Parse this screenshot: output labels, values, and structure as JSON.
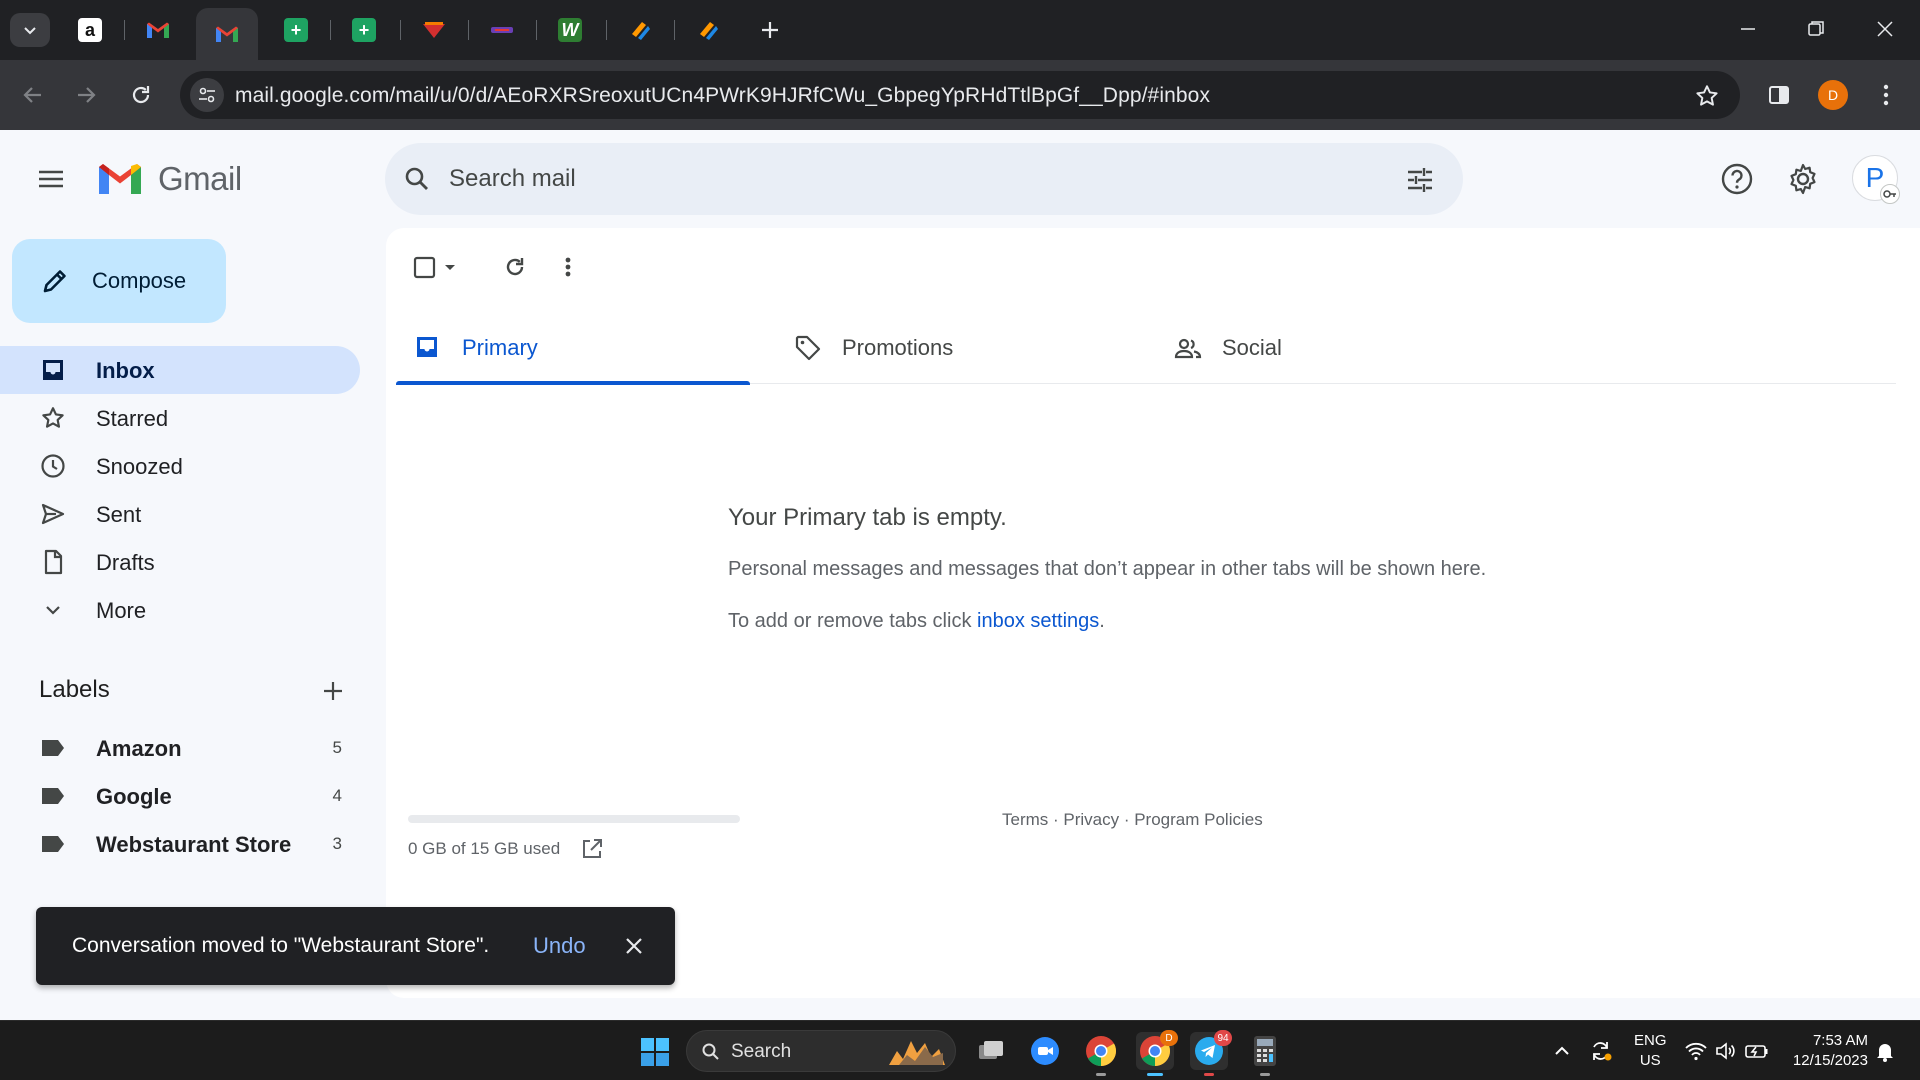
{
  "browser": {
    "tabs": [
      {
        "name": "amazon",
        "glyph": "a"
      },
      {
        "name": "gmail-1",
        "glyph": "M"
      },
      {
        "name": "gmail-active",
        "glyph": "M"
      },
      {
        "name": "sheets-1",
        "glyph": "+"
      },
      {
        "name": "sheets-2",
        "glyph": "+"
      },
      {
        "name": "app-red",
        "glyph": ""
      },
      {
        "name": "app-purple",
        "glyph": ""
      },
      {
        "name": "w-app",
        "glyph": "W"
      },
      {
        "name": "app-orange-1",
        "glyph": ""
      },
      {
        "name": "app-orange-2",
        "glyph": ""
      }
    ],
    "url": "mail.google.com/mail/u/0/d/AEoRXRSreoxutUCn4PWrK9HJRfCWu_GbpegYpRHdTtlBpGf__Dpp/#inbox",
    "profile_initial": "D"
  },
  "gmail": {
    "logo_text": "Gmail",
    "search_placeholder": "Search mail",
    "avatar_initial": "P",
    "compose_label": "Compose",
    "nav": [
      {
        "label": "Inbox",
        "icon": "inbox-icon",
        "active": true
      },
      {
        "label": "Starred",
        "icon": "star-icon"
      },
      {
        "label": "Snoozed",
        "icon": "clock-icon"
      },
      {
        "label": "Sent",
        "icon": "send-icon"
      },
      {
        "label": "Drafts",
        "icon": "draft-icon"
      },
      {
        "label": "More",
        "icon": "chevron-down-icon"
      }
    ],
    "labels_title": "Labels",
    "labels": [
      {
        "name": "Amazon",
        "count": "5"
      },
      {
        "name": "Google",
        "count": "4"
      },
      {
        "name": "Webstaurant Store",
        "count": "3"
      }
    ],
    "tabs": [
      {
        "label": "Primary",
        "active": true
      },
      {
        "label": "Promotions"
      },
      {
        "label": "Social"
      }
    ],
    "empty": {
      "title": "Your Primary tab is empty.",
      "description": "Personal messages and messages that don’t appear in other tabs will be shown here.",
      "settings_prefix": "To add or remove tabs click ",
      "settings_link": "inbox settings",
      "settings_suffix": "."
    },
    "storage": {
      "text": "0 GB of 15 GB used",
      "used_fraction": 0
    },
    "footer": "Terms · Privacy · Program Policies",
    "snackbar": {
      "message": "Conversation moved to \"Webstaurant Store\".",
      "action": "Undo"
    },
    "colors": {
      "accent": "#0b57d0",
      "compose_bg": "#c2e7ff",
      "active_nav": "#d3e3fd"
    }
  },
  "taskbar": {
    "search_label": "Search",
    "telegram_badge": "94",
    "chrome_badge": "D",
    "language": "ENG",
    "region": "US",
    "time": "7:53 AM",
    "date": "12/15/2023"
  }
}
